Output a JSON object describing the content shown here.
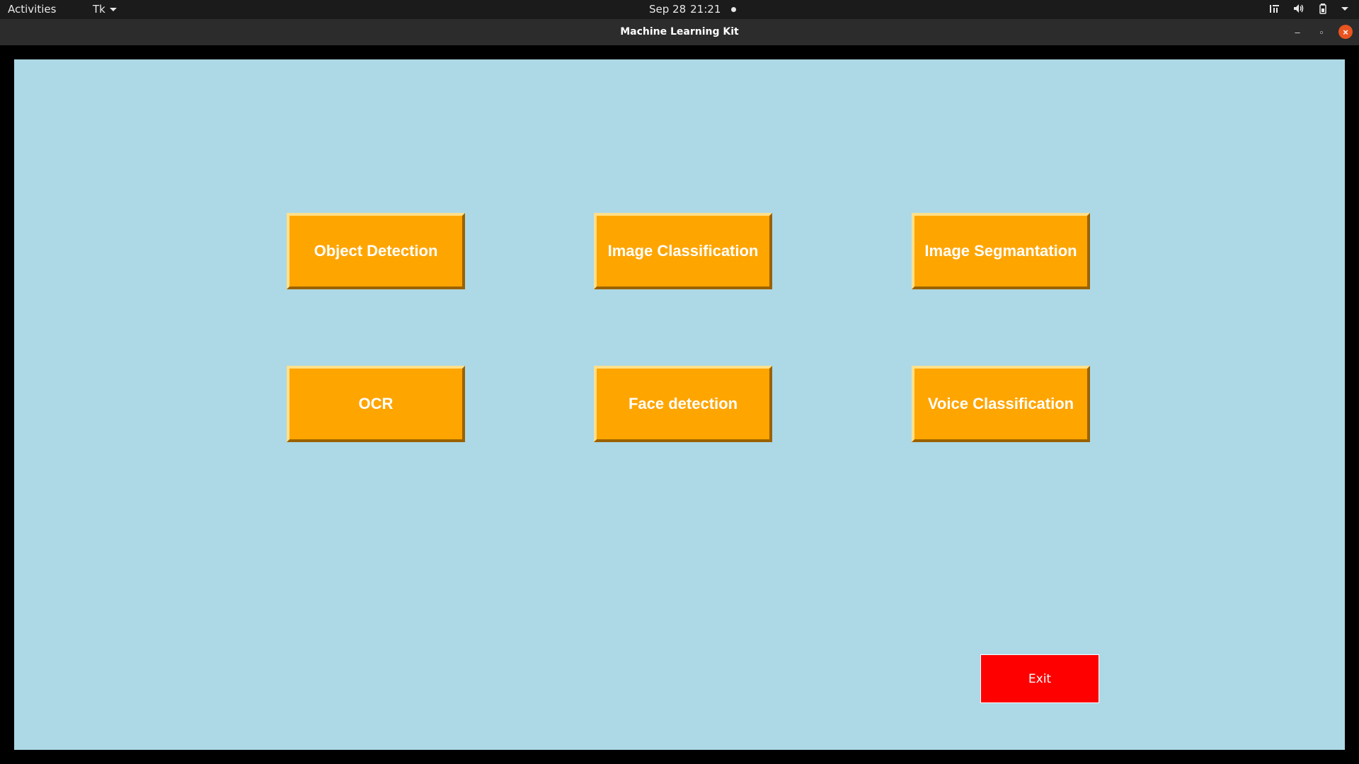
{
  "topbar": {
    "activities": "Activities",
    "app_menu": "Tk",
    "date": "Sep 28",
    "time": "21:21",
    "tray_icons": [
      "network-icon",
      "volume-icon",
      "battery-icon",
      "system-menu-chevron-icon"
    ]
  },
  "window": {
    "title": "Machine Learning Kit",
    "controls": {
      "minimize": "–",
      "maximize": "▫",
      "close": "×"
    }
  },
  "buttons": [
    {
      "label": "Object Detection"
    },
    {
      "label": "Image Classification"
    },
    {
      "label": "Image Segmantation"
    },
    {
      "label": "OCR"
    },
    {
      "label": "Face detection"
    },
    {
      "label": "Voice Classification"
    }
  ],
  "exit": {
    "label": "Exit"
  },
  "colors": {
    "background": "#add8e6",
    "button_face": "#ffa500",
    "exit_button": "#ff0000",
    "close_button": "#e95420"
  }
}
